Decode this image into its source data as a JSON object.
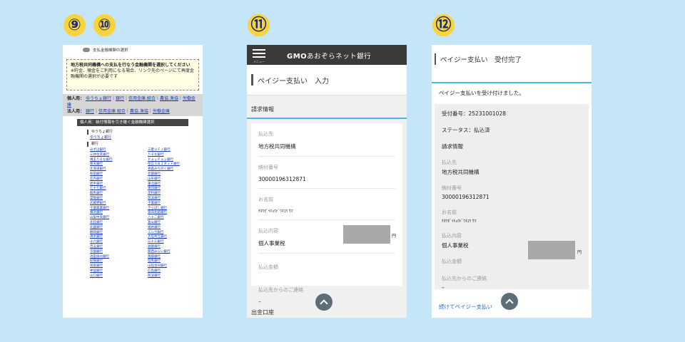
{
  "steps": [
    "⑨",
    "⑩",
    "⑪",
    "⑫"
  ],
  "panel1": {
    "header": "支払金融機関の選択",
    "notice": [
      "地方税共同機構への支払を行なう金融機関を選択してください",
      "※貯金、預金をご利用になる場合、リンク先のページにて再度金融機関の選択が必要です"
    ],
    "personal_label": "個人用：",
    "personal_links": [
      "ゆうちょ銀行",
      "銀行",
      "信用金庫.組合",
      "農協.漁協",
      "労働金庫"
    ],
    "corporate_label": "法人用：",
    "corporate_links": [
      "銀行",
      "信用金庫.組合",
      "農協.漁協",
      "労働金庫"
    ],
    "select_bar": "個人用：納付情報を引き継ぐ金融機関選択",
    "yucho_section": "ゆうちょ銀行",
    "yucho_link": "ゆうちょ銀行",
    "bank_section": "銀行",
    "banks": [
      "みずほ銀行",
      "三菱ＵＦＪ銀行",
      "三井住友銀行",
      "りそな銀行",
      "埼玉りそな銀行",
      "ＰａｙＰａｙ銀行",
      "楽天銀行",
      "住信ＳＢＩネット銀行",
      "北海道銀行",
      "青森みちのく銀行",
      "秋田銀行",
      "北都銀行",
      "荘内銀行",
      "山形銀行",
      "岩手銀行",
      "東北銀行",
      "七十七銀行",
      "東邦銀行",
      "群馬銀行",
      "足利銀行",
      "常陽銀行",
      "筑波銀行",
      "武蔵野銀行",
      "千葉銀行",
      "千葉興業銀行",
      "きらぼし銀行",
      "横浜銀行",
      "第四北越銀行",
      "山梨中央銀行",
      "八十二銀行",
      "北陸銀行",
      "富山銀行",
      "北國銀行",
      "福井銀行",
      "静岡銀行",
      "スルガ銀行",
      "清水銀行",
      "大垣共立銀行",
      "十六銀行",
      "三十三銀行",
      "百五銀行",
      "滋賀銀行",
      "京都銀行",
      "関西みらい銀行",
      "池田泉州銀行",
      "南都銀行",
      "紀陽銀行",
      "但馬銀行",
      "鳥取銀行",
      "山陰合同銀行",
      "中国銀行",
      "広島銀行",
      "山口銀行",
      "阿波銀行"
    ]
  },
  "panel2": {
    "menu_caption": "メニュー",
    "logo_brand": "GMO",
    "logo_name": "あおぞらネット銀行",
    "title": "ペイジー支払い　入力",
    "section": "請求情報",
    "fields": [
      {
        "label": "払込先",
        "value": "地方税共同機構"
      },
      {
        "label": "納付番号",
        "value": "30000196312871"
      },
      {
        "label": "お名前",
        "value": "ﾁﾎｳｾﾞｲｷｮｳﾄﾞｳｷｺｳ ｻﾏ"
      },
      {
        "label": "払込内容",
        "value": "個人事業税"
      }
    ],
    "amount_label": "払込金額",
    "yen": "円",
    "contact_label": "払込先からのご連絡",
    "contact_value": "–",
    "next_section": "出金口座"
  },
  "panel3": {
    "title": "ペイジー支払い　受付完了",
    "message": "ペイジー支払いを受け付けました。",
    "receipt": "受付番号：25231001028",
    "status": "ステータス：払込済",
    "billing": "請求情報",
    "fields": [
      {
        "label": "払込先",
        "value": "地方税共同機構"
      },
      {
        "label": "納付番号",
        "value": "30000196312871"
      },
      {
        "label": "お名前",
        "value": "ﾁﾎｳｾﾞｲｷｮｳﾄﾞｳｷｺｳ ｻﾏ"
      },
      {
        "label": "払込内容",
        "value": "個人事業税"
      }
    ],
    "amount_label": "払込金額",
    "yen": "円",
    "contact_label": "払込先からのご連絡",
    "contact_value": "–",
    "continue_link": "続けてペイジー支払い"
  }
}
